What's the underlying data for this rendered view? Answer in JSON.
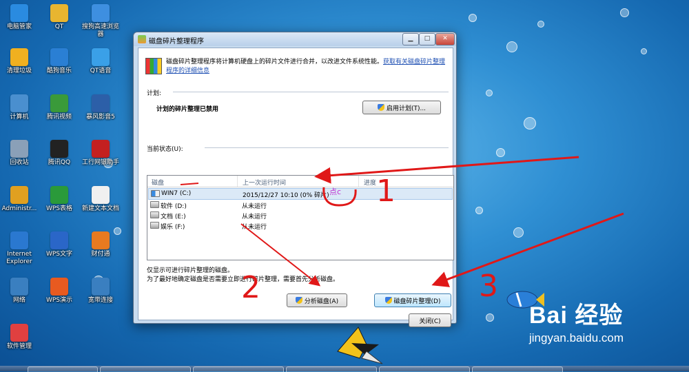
{
  "desktop_icons": [
    {
      "label": "电脑管家",
      "color": "#2a8be0"
    },
    {
      "label": "QT",
      "color": "#e8b530"
    },
    {
      "label": "搜狗高速浏览器",
      "color": "#3e8fe0"
    },
    {
      "label": "清理垃圾",
      "color": "#f0b020"
    },
    {
      "label": "酷狗音乐",
      "color": "#2a7fd4"
    },
    {
      "label": "QT语音",
      "color": "#3aa0e8"
    },
    {
      "label": "计算机",
      "color": "#4a8fcf"
    },
    {
      "label": "腾讯视频",
      "color": "#3a9a3a"
    },
    {
      "label": "暴风影音5",
      "color": "#2c5fa8"
    },
    {
      "label": "回收站",
      "color": "#8aa0b8"
    },
    {
      "label": "腾讯QQ",
      "color": "#222222"
    },
    {
      "label": "工行网银助手",
      "color": "#c42020"
    },
    {
      "label": "Administr...",
      "color": "#e0a020"
    },
    {
      "label": "WPS表格",
      "color": "#2a9a3a"
    },
    {
      "label": "新建文本文档",
      "color": "#f0f0f0"
    },
    {
      "label": "Internet Explorer",
      "color": "#2a78d0"
    },
    {
      "label": "WPS文字",
      "color": "#2a66c8"
    },
    {
      "label": "财付通",
      "color": "#e87a20"
    },
    {
      "label": "网络",
      "color": "#3a7fc0"
    },
    {
      "label": "WPS演示",
      "color": "#e85a20"
    },
    {
      "label": "宽带连接",
      "color": "#3a7fc0"
    },
    {
      "label": "软件管理",
      "color": "#e04040"
    }
  ],
  "window": {
    "title": "磁盘碎片整理程序",
    "min": "▁",
    "max": "□",
    "close": "✕",
    "description": "磁盘碎片整理程序将计算机硬盘上的碎片文件进行合并，以改进文件系统性能。",
    "link": "获取有关磁盘碎片整理程序的详细信息",
    "schedule_label": "计划:",
    "schedule_status": "计划的碎片整理已禁用",
    "schedule_button": "启用计划(T)...",
    "current_status_label": "当前状态(U):",
    "columns": [
      "磁盘",
      "上一次运行时间",
      "进度"
    ],
    "disks": [
      {
        "name": "WIN7 (C:)",
        "last_run": "2015/12/27 10:10 (0% 碎片)"
      },
      {
        "name": "软件 (D:)",
        "last_run": "从未运行"
      },
      {
        "name": "文档 (E:)",
        "last_run": "从未运行"
      },
      {
        "name": "娱乐 (F:)",
        "last_run": "从未运行"
      }
    ],
    "note1": "仅显示可进行碎片整理的磁盘。",
    "note2": "为了最好地确定磁盘是否需要立即进行碎片整理，需要首先分析磁盘。",
    "analyze_button": "分析磁盘(A)",
    "defrag_button": "磁盘碎片整理(D)",
    "close_button": "关闭(C)"
  },
  "annotations": {
    "label_c": "点c",
    "num1": "1",
    "num2": "2",
    "num3": "3",
    "arrow_color": "#e01818",
    "label_color": "#c030d0"
  },
  "watermark": {
    "brand": "Bai 经验",
    "url": "jingyan.baidu.com"
  }
}
